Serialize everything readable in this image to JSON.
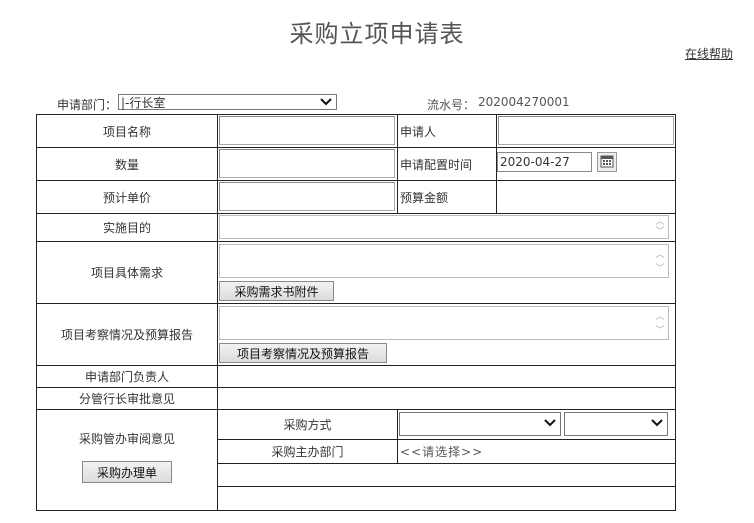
{
  "page": {
    "title": "采购立项申请表",
    "help_link": "在线帮助"
  },
  "header": {
    "dept_label": "申请部门：",
    "dept_value": "|-行长室",
    "serial_label": "流水号：",
    "serial_value": "202004270001"
  },
  "form": {
    "project_name_label": "项目名称",
    "applicant_label": "申请人",
    "quantity_label": "数量",
    "apply_time_label": "申请配置时间",
    "apply_time_value": "2020-04-27",
    "unit_price_label": "预计单价",
    "budget_label": "预算金额",
    "purpose_label": "实施目的",
    "requirements_label": "项目具体需求",
    "requirements_button": "采购需求书附件",
    "survey_label": "项目考察情况及预算报告",
    "survey_button": "项目考察情况及预算报告",
    "dept_head_label": "申请部门负责人",
    "vp_opinion_label": "分管行长审批意见",
    "procurement_opinion_label": "采购管办审阅意见",
    "procurement_button": "采购办理单",
    "method_label": "采购方式",
    "host_dept_label": "采购主办部门",
    "host_dept_value": "<<请选择>>"
  },
  "icons": {
    "calendar": "calendar-icon",
    "chevron": "chevron-down-icon"
  }
}
